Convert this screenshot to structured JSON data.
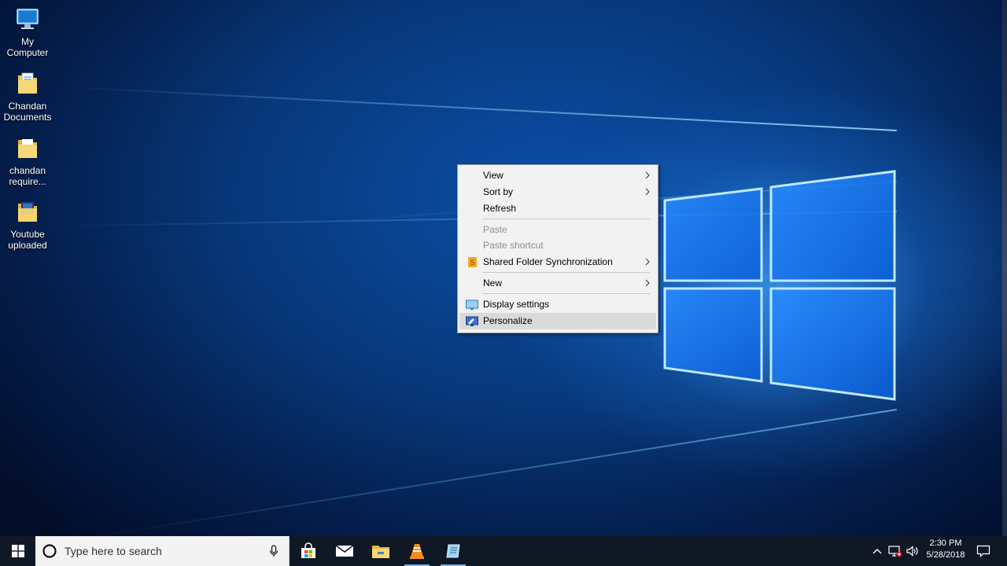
{
  "desktop": {
    "icons": [
      {
        "label": "My\nComputer",
        "icon": "computer-icon"
      },
      {
        "label": "Chandan\nDocuments",
        "icon": "folder-documents-icon"
      },
      {
        "label": "chandan\nrequire...",
        "icon": "folder-icon"
      },
      {
        "label": "Youtube\nuploaded",
        "icon": "folder-video-icon"
      }
    ]
  },
  "context_menu": {
    "items": [
      {
        "label": "View",
        "submenu": true
      },
      {
        "label": "Sort by",
        "submenu": true
      },
      {
        "label": "Refresh"
      },
      {
        "label": "Paste",
        "disabled": true
      },
      {
        "label": "Paste shortcut",
        "disabled": true
      },
      {
        "label": "Shared Folder Synchronization",
        "submenu": true,
        "icon": "sync-app-icon"
      },
      {
        "label": "New",
        "submenu": true
      },
      {
        "label": "Display settings",
        "icon": "display-icon"
      },
      {
        "label": "Personalize",
        "icon": "personalize-icon",
        "highlighted": true
      }
    ]
  },
  "taskbar": {
    "search_placeholder": "Type here to search",
    "pinned": [
      "store-icon",
      "mail-icon",
      "file-explorer-icon",
      "vlc-icon",
      "notepad-icon"
    ],
    "tray": {
      "time": "2:30 PM",
      "date": "5/28/2018"
    }
  },
  "colors": {
    "taskbar": "#101826",
    "menu_bg": "#f2f2f2",
    "menu_highlight": "#dadada"
  }
}
